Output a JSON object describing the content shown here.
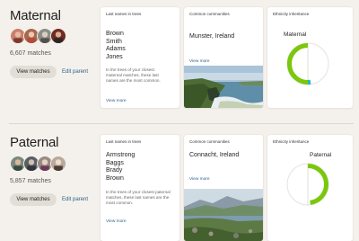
{
  "maternal": {
    "title": "Maternal",
    "matches": "6,607 matches",
    "view_matches": "View matches",
    "edit_parent": "Edit parent",
    "last_names_card": {
      "header": "Last names in trees",
      "names": [
        "Brown",
        "Smith",
        "Adams",
        "Jones"
      ],
      "description": "In the trees of your closest maternal matches, these last names are the most common.",
      "view_more": "View more"
    },
    "communities_card": {
      "header": "Common communities",
      "region": "Munster, Ireland",
      "view_more": "View more",
      "photo": "coastal-cliffs-photo"
    },
    "ethnicity_card": {
      "header": "Ethnicity inheritance",
      "label": "Maternal",
      "fraction": 0.52,
      "accent": "#7ac70c",
      "secondary_accent": "#1fb5c4"
    }
  },
  "paternal": {
    "title": "Paternal",
    "matches": "5,857 matches",
    "view_matches": "View matches",
    "edit_parent": "Edit parent",
    "last_names_card": {
      "header": "Last names in trees",
      "names": [
        "Armstrong",
        "Baggs",
        "Brady",
        "Brown"
      ],
      "description": "In the trees of your closest paternal matches, these last names are the most common.",
      "view_more": "View more"
    },
    "communities_card": {
      "header": "Common communities",
      "region": "Connacht, Ireland",
      "view_more": "View more",
      "photo": "hills-lake-photo"
    },
    "ethnicity_card": {
      "header": "Ethnicity inheritance",
      "label": "Paternal",
      "fraction": 0.48,
      "accent": "#7ac70c"
    }
  },
  "colors": {
    "background": "#f4f1ec",
    "link": "#2c5f8a",
    "button": "#e2ded7"
  }
}
